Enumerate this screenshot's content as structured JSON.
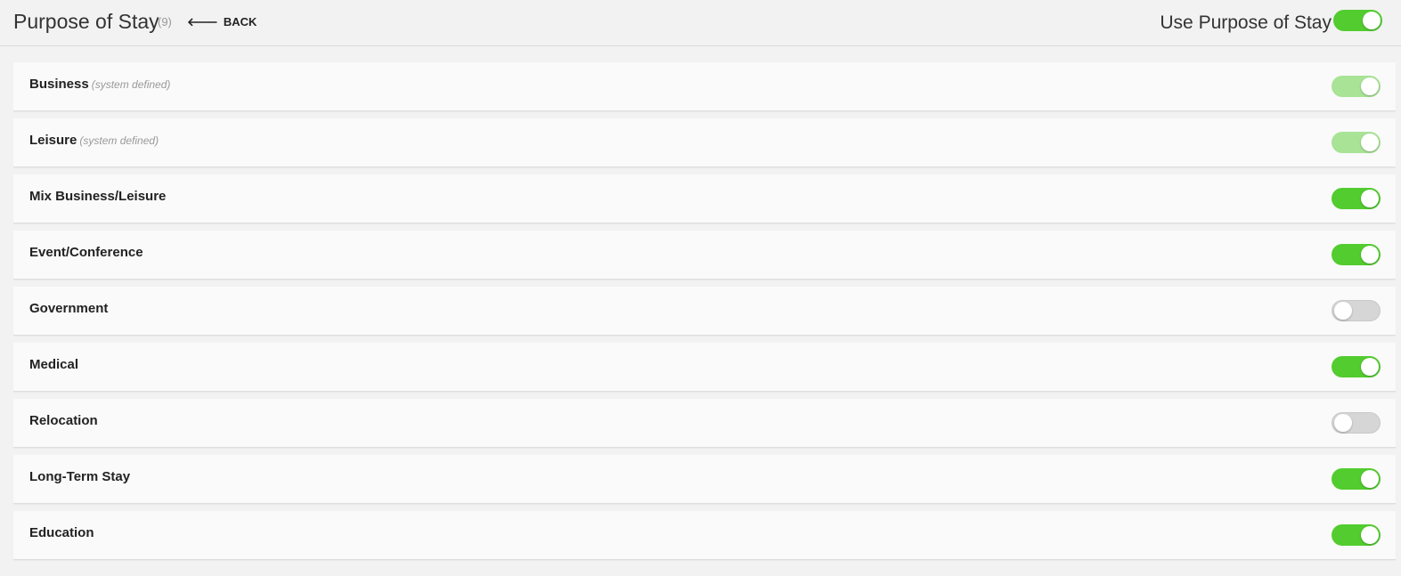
{
  "header": {
    "title": "Purpose of Stay",
    "count": "(9)",
    "back_label": "BACK",
    "use_label": "Use Purpose of Stay",
    "use_enabled": true
  },
  "items": [
    {
      "label": "Business",
      "note": "(system defined)",
      "enabled": true,
      "locked": true
    },
    {
      "label": "Leisure",
      "note": "(system defined)",
      "enabled": true,
      "locked": true
    },
    {
      "label": "Mix Business/Leisure",
      "note": "",
      "enabled": true,
      "locked": false
    },
    {
      "label": "Event/Conference",
      "note": "",
      "enabled": true,
      "locked": false
    },
    {
      "label": "Government",
      "note": "",
      "enabled": false,
      "locked": false
    },
    {
      "label": "Medical",
      "note": "",
      "enabled": true,
      "locked": false
    },
    {
      "label": "Relocation",
      "note": "",
      "enabled": false,
      "locked": false
    },
    {
      "label": "Long-Term Stay",
      "note": "",
      "enabled": true,
      "locked": false
    },
    {
      "label": "Education",
      "note": "",
      "enabled": true,
      "locked": false
    }
  ],
  "colors": {
    "toggle_on": "#52cc2f",
    "toggle_locked": "#a8e396",
    "toggle_off": "#d6d6d6"
  }
}
